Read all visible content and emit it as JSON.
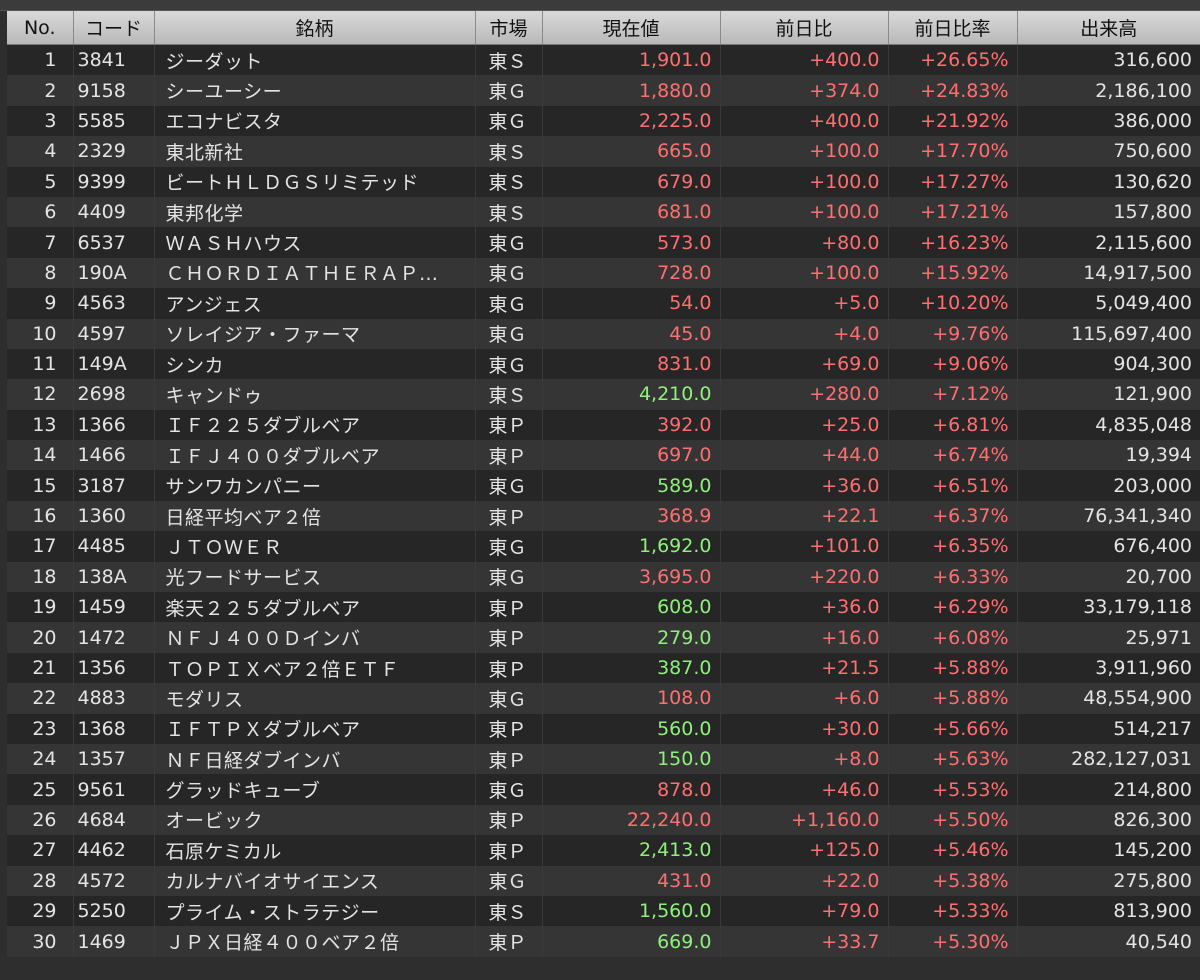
{
  "colors": {
    "price_up": "#ff6f6f",
    "price_strong": "#8ef27a",
    "change_up": "#ff6f6f",
    "text": "#e4e4e4"
  },
  "columns": {
    "no": "No.",
    "code": "コード",
    "name": "銘柄",
    "market": "市場",
    "price": "現在値",
    "change": "前日比",
    "rate": "前日比率",
    "volume": "出来高"
  },
  "rows": [
    {
      "no": "1",
      "code": "3841",
      "name": "ジーダット",
      "market": "東Ｓ",
      "price": "1,901.0",
      "price_color": "red",
      "change": "+400.0",
      "rate": "+26.65%",
      "volume": "316,600"
    },
    {
      "no": "2",
      "code": "9158",
      "name": "シーユーシー",
      "market": "東Ｇ",
      "price": "1,880.0",
      "price_color": "red",
      "change": "+374.0",
      "rate": "+24.83%",
      "volume": "2,186,100"
    },
    {
      "no": "3",
      "code": "5585",
      "name": "エコナビスタ",
      "market": "東Ｇ",
      "price": "2,225.0",
      "price_color": "red",
      "change": "+400.0",
      "rate": "+21.92%",
      "volume": "386,000"
    },
    {
      "no": "4",
      "code": "2329",
      "name": "東北新社",
      "market": "東Ｓ",
      "price": "665.0",
      "price_color": "red",
      "change": "+100.0",
      "rate": "+17.70%",
      "volume": "750,600"
    },
    {
      "no": "5",
      "code": "9399",
      "name": "ビートＨＬＤＧＳリミテッド",
      "market": "東Ｓ",
      "price": "679.0",
      "price_color": "red",
      "change": "+100.0",
      "rate": "+17.27%",
      "volume": "130,620"
    },
    {
      "no": "6",
      "code": "4409",
      "name": "東邦化学",
      "market": "東Ｓ",
      "price": "681.0",
      "price_color": "red",
      "change": "+100.0",
      "rate": "+17.21%",
      "volume": "157,800"
    },
    {
      "no": "7",
      "code": "6537",
      "name": "ＷＡＳＨハウス",
      "market": "東Ｇ",
      "price": "573.0",
      "price_color": "red",
      "change": "+80.0",
      "rate": "+16.23%",
      "volume": "2,115,600"
    },
    {
      "no": "8",
      "code": "190A",
      "name": "ＣＨＯＲＤＩＡＴＨＥＲＡＰ…",
      "market": "東Ｇ",
      "price": "728.0",
      "price_color": "red",
      "change": "+100.0",
      "rate": "+15.92%",
      "volume": "14,917,500"
    },
    {
      "no": "9",
      "code": "4563",
      "name": "アンジェス",
      "market": "東Ｇ",
      "price": "54.0",
      "price_color": "red",
      "change": "+5.0",
      "rate": "+10.20%",
      "volume": "5,049,400"
    },
    {
      "no": "10",
      "code": "4597",
      "name": "ソレイジア・ファーマ",
      "market": "東Ｇ",
      "price": "45.0",
      "price_color": "red",
      "change": "+4.0",
      "rate": "+9.76%",
      "volume": "115,697,400"
    },
    {
      "no": "11",
      "code": "149A",
      "name": "シンカ",
      "market": "東Ｇ",
      "price": "831.0",
      "price_color": "red",
      "change": "+69.0",
      "rate": "+9.06%",
      "volume": "904,300"
    },
    {
      "no": "12",
      "code": "2698",
      "name": "キャンドゥ",
      "market": "東Ｓ",
      "price": "4,210.0",
      "price_color": "green",
      "change": "+280.0",
      "rate": "+7.12%",
      "volume": "121,900"
    },
    {
      "no": "13",
      "code": "1366",
      "name": "ＩＦ２２５ダブルベア",
      "market": "東Ｐ",
      "price": "392.0",
      "price_color": "red",
      "change": "+25.0",
      "rate": "+6.81%",
      "volume": "4,835,048"
    },
    {
      "no": "14",
      "code": "1466",
      "name": "ＩＦＪ４００ダブルベア",
      "market": "東Ｐ",
      "price": "697.0",
      "price_color": "red",
      "change": "+44.0",
      "rate": "+6.74%",
      "volume": "19,394"
    },
    {
      "no": "15",
      "code": "3187",
      "name": "サンワカンパニー",
      "market": "東Ｇ",
      "price": "589.0",
      "price_color": "green",
      "change": "+36.0",
      "rate": "+6.51%",
      "volume": "203,000"
    },
    {
      "no": "16",
      "code": "1360",
      "name": "日経平均ベア２倍",
      "market": "東Ｐ",
      "price": "368.9",
      "price_color": "red",
      "change": "+22.1",
      "rate": "+6.37%",
      "volume": "76,341,340"
    },
    {
      "no": "17",
      "code": "4485",
      "name": "ＪＴＯＷＥＲ",
      "market": "東Ｇ",
      "price": "1,692.0",
      "price_color": "green",
      "change": "+101.0",
      "rate": "+6.35%",
      "volume": "676,400"
    },
    {
      "no": "18",
      "code": "138A",
      "name": "光フードサービス",
      "market": "東Ｇ",
      "price": "3,695.0",
      "price_color": "red",
      "change": "+220.0",
      "rate": "+6.33%",
      "volume": "20,700"
    },
    {
      "no": "19",
      "code": "1459",
      "name": "楽天２２５ダブルベア",
      "market": "東Ｐ",
      "price": "608.0",
      "price_color": "green",
      "change": "+36.0",
      "rate": "+6.29%",
      "volume": "33,179,118"
    },
    {
      "no": "20",
      "code": "1472",
      "name": "ＮＦＪ４００Ｄインバ",
      "market": "東Ｐ",
      "price": "279.0",
      "price_color": "green",
      "change": "+16.0",
      "rate": "+6.08%",
      "volume": "25,971"
    },
    {
      "no": "21",
      "code": "1356",
      "name": "ＴＯＰＩＸベア２倍ＥＴＦ",
      "market": "東Ｐ",
      "price": "387.0",
      "price_color": "green",
      "change": "+21.5",
      "rate": "+5.88%",
      "volume": "3,911,960"
    },
    {
      "no": "22",
      "code": "4883",
      "name": "モダリス",
      "market": "東Ｇ",
      "price": "108.0",
      "price_color": "red",
      "change": "+6.0",
      "rate": "+5.88%",
      "volume": "48,554,900"
    },
    {
      "no": "23",
      "code": "1368",
      "name": "ＩＦＴＰＸダブルベア",
      "market": "東Ｐ",
      "price": "560.0",
      "price_color": "green",
      "change": "+30.0",
      "rate": "+5.66%",
      "volume": "514,217"
    },
    {
      "no": "24",
      "code": "1357",
      "name": "ＮＦ日経ダブインバ",
      "market": "東Ｐ",
      "price": "150.0",
      "price_color": "green",
      "change": "+8.0",
      "rate": "+5.63%",
      "volume": "282,127,031"
    },
    {
      "no": "25",
      "code": "9561",
      "name": "グラッドキューブ",
      "market": "東Ｇ",
      "price": "878.0",
      "price_color": "red",
      "change": "+46.0",
      "rate": "+5.53%",
      "volume": "214,800"
    },
    {
      "no": "26",
      "code": "4684",
      "name": "オービック",
      "market": "東Ｐ",
      "price": "22,240.0",
      "price_color": "red",
      "change": "+1,160.0",
      "rate": "+5.50%",
      "volume": "826,300"
    },
    {
      "no": "27",
      "code": "4462",
      "name": "石原ケミカル",
      "market": "東Ｐ",
      "price": "2,413.0",
      "price_color": "green",
      "change": "+125.0",
      "rate": "+5.46%",
      "volume": "145,200"
    },
    {
      "no": "28",
      "code": "4572",
      "name": "カルナバイオサイエンス",
      "market": "東Ｇ",
      "price": "431.0",
      "price_color": "red",
      "change": "+22.0",
      "rate": "+5.38%",
      "volume": "275,800"
    },
    {
      "no": "29",
      "code": "5250",
      "name": "プライム・ストラテジー",
      "market": "東Ｓ",
      "price": "1,560.0",
      "price_color": "green",
      "change": "+79.0",
      "rate": "+5.33%",
      "volume": "813,900"
    },
    {
      "no": "30",
      "code": "1469",
      "name": "ＪＰＸ日経４００ベア２倍",
      "market": "東Ｐ",
      "price": "669.0",
      "price_color": "green",
      "change": "+33.7",
      "rate": "+5.30%",
      "volume": "40,540"
    }
  ]
}
